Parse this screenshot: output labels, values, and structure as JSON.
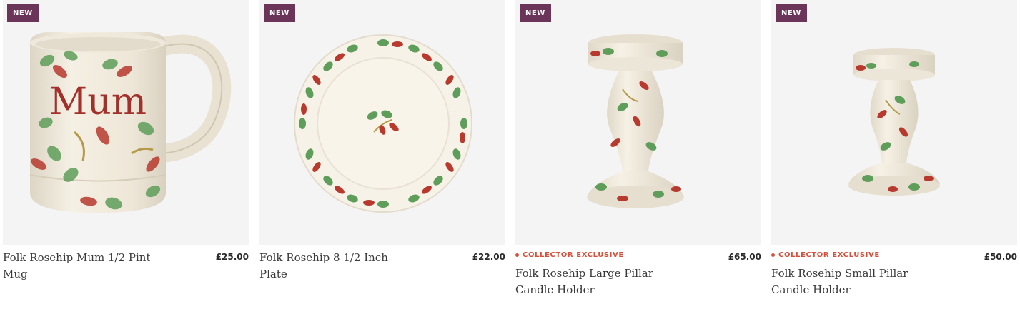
{
  "products": [
    {
      "badge": "NEW",
      "title": "Folk Rosehip Mum 1/2 Pint Mug",
      "price": "£25.00",
      "image_text": "Mum"
    },
    {
      "badge": "NEW",
      "title": "Folk Rosehip 8 1/2 Inch Plate",
      "price": "£22.00"
    },
    {
      "badge": "NEW",
      "tag": "COLLECTOR EXCLUSIVE",
      "title": "Folk Rosehip Large Pillar Candle Holder",
      "price": "£65.00"
    },
    {
      "badge": "NEW",
      "tag": "COLLECTOR EXCLUSIVE",
      "title": "Folk Rosehip Small Pillar Candle Holder",
      "price": "£50.00"
    }
  ],
  "colors": {
    "badge_bg": "#6b3459",
    "exclusive": "#d8503c",
    "card_bg": "#f4f4f4"
  }
}
